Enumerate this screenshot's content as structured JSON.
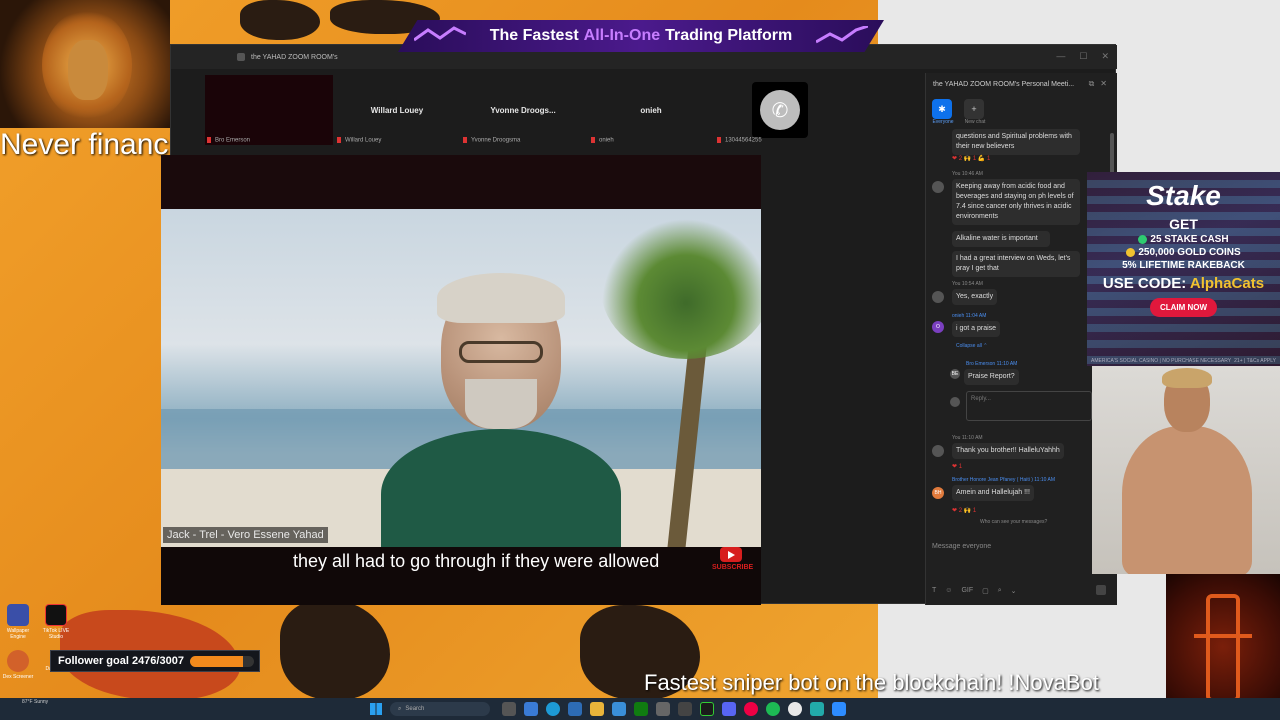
{
  "overlay": {
    "disclaimer": "Never financial advice",
    "promo_prefix": "The Fastest",
    "promo_accent": "All-In-One",
    "promo_suffix": "Trading Platform",
    "sniper": "Fastest sniper bot on the blockchain! !NovaBot",
    "follower_goal": "Follower goal 2476/3007",
    "follower_progress": 0.823
  },
  "zoom": {
    "window_title": "the YAHAD ZOOM ROOM's",
    "participants": [
      {
        "name": "",
        "label": "Bro Emerson"
      },
      {
        "name": "Willard Louey",
        "label": "Willard Louey"
      },
      {
        "name": "Yvonne Droogs...",
        "label": "Yvonne Droogsma"
      },
      {
        "name": "onieh",
        "label": "onieh"
      },
      {
        "name": "",
        "label": "13044564255"
      }
    ],
    "speaker_name": "Jack - Trel - Vero Essene Yahad",
    "caption": "they all had to go through if they were allowed",
    "subscribe": "SUBSCRIBE"
  },
  "chat": {
    "title": "the YAHAD ZOOM ROOM's Personal Meeti...",
    "tabs": [
      {
        "label": "Everyone",
        "icon": "people-icon"
      },
      {
        "label": "New chat",
        "icon": "plus-icon"
      }
    ],
    "messages": {
      "m0_text": "questions and Spiritual problems with their new believers",
      "m0_react": "❤ 2  🙌 1  💪 1",
      "m1_meta": "You 10:46 AM",
      "m1_text": "Keeping away from acidic food and beverages and staying on ph levels of 7.4 since cancer only thrives in acidic environments",
      "m2_text": "Alkaline water is important",
      "m3_text": "I had a great interview on Weds, let's pray I get that",
      "m4_meta": "You 10:54 AM",
      "m4_text": "Yes, exactly",
      "m5_meta": "onieh 11:04 AM",
      "m5_text": "i got a praise",
      "collapse": "Collapse all ⌃",
      "m6_meta": "Bro Emerson 11:10 AM",
      "m6_text": "Praise Report?",
      "reply": "Reply...",
      "m7_meta": "You 11:10 AM",
      "m7_text": "Thank you brother!! HalleluYahhh",
      "m7_react": "❤ 1",
      "m8_meta": "Brother Honore Jean Pfaney ( Haiti ) 11:10 AM",
      "m8_text": "Amein and Hallelujah !!!",
      "m8_react": "❤ 2  🙌 1",
      "visibility": "Who can see your messages?"
    },
    "composer_placeholder": "Message everyone"
  },
  "stake": {
    "logo": "Stake",
    "get": "GET",
    "line1": "25 STAKE CASH",
    "line2": "250,000 GOLD COINS",
    "line3": "5% LIFETIME RAKEBACK",
    "code_prefix": "USE CODE: ",
    "code": "AlphaCats",
    "claim": "CLAIM NOW",
    "fine_left": "AMERICA'S SOCIAL CASINO | NO PURCHASE NECESSARY",
    "fine_right": "21+ | T&Cs APPLY"
  },
  "desktop": {
    "icons": [
      {
        "label": "Wallpaper Engine"
      },
      {
        "label": "TikTok LIVE Studio"
      },
      {
        "label": "Dex Screener"
      },
      {
        "label": "Darkness"
      }
    ],
    "weather": "87°F Sunny",
    "search_placeholder": "Search"
  },
  "colors": {
    "accent_purple": "#c77dff",
    "zoom_blue": "#0e71eb",
    "stake_red": "#e0183c",
    "progress_orange": "#f28a1c"
  }
}
